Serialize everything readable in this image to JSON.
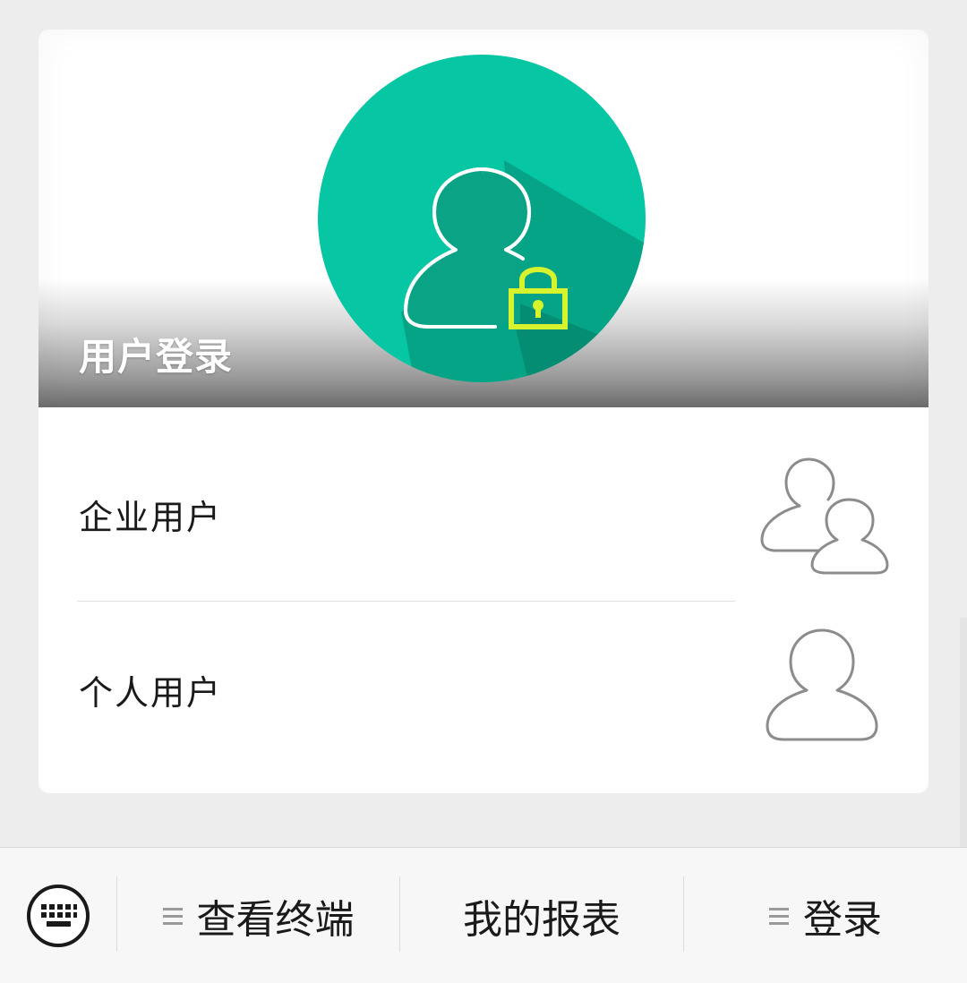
{
  "banner": {
    "title": "用户登录",
    "hero_icon": "user-lock-icon",
    "circle_color": "#06c6a4",
    "lock_color": "#d6f32d"
  },
  "login_options": [
    {
      "label": "企业用户",
      "icon": "users-icon"
    },
    {
      "label": "个人用户",
      "icon": "user-icon"
    }
  ],
  "bottom_menu": {
    "keyboard_icon": "keyboard-icon",
    "items": [
      {
        "label": "查看终端",
        "has_submenu": true
      },
      {
        "label": "我的报表",
        "has_submenu": false
      },
      {
        "label": "登录",
        "has_submenu": true
      }
    ]
  }
}
